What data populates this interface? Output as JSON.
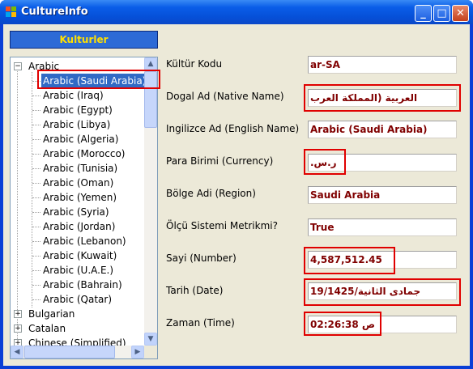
{
  "window": {
    "title": "CultureInfo",
    "icon": "windows-form-icon",
    "buttons": {
      "minimize": "_",
      "maximize": "□",
      "close": "✕"
    }
  },
  "sidebar": {
    "button_label": "Kulturler",
    "tree": {
      "groups": [
        {
          "label": "Arabic",
          "expanded": true,
          "expander": "−"
        },
        {
          "label": "Bulgarian",
          "expanded": false,
          "expander": "+"
        },
        {
          "label": "Catalan",
          "expanded": false,
          "expander": "+"
        },
        {
          "label": "Chinese (Simplified)",
          "expanded": false,
          "expander": "+"
        }
      ],
      "arabic_children": [
        "Arabic (Saudi Arabia)",
        "Arabic (Iraq)",
        "Arabic (Egypt)",
        "Arabic (Libya)",
        "Arabic (Algeria)",
        "Arabic (Morocco)",
        "Arabic (Tunisia)",
        "Arabic (Oman)",
        "Arabic (Yemen)",
        "Arabic (Syria)",
        "Arabic (Jordan)",
        "Arabic (Lebanon)",
        "Arabic (Kuwait)",
        "Arabic (U.A.E.)",
        "Arabic (Bahrain)",
        "Arabic (Qatar)"
      ],
      "selected": "Arabic (Saudi Arabia)"
    }
  },
  "fields": [
    {
      "label": "Kültür Kodu",
      "value": "ar-SA"
    },
    {
      "label": "Dogal Ad (Native Name)",
      "value": "العربية (المملكة العرب"
    },
    {
      "label": "Ingilizce Ad (English Name)",
      "value": "Arabic (Saudi Arabia)"
    },
    {
      "label": "Para Birimi (Currency)",
      "value": "ر.س.‏"
    },
    {
      "label": "Bölge Adi (Region)",
      "value": "Saudi Arabia"
    },
    {
      "label": "Ölçü Sistemi Metrikmi?",
      "value": "True"
    },
    {
      "label": "Sayi (Number)",
      "value": "4,587,512.45"
    },
    {
      "label": "Tarih (Date)",
      "value": "19/جمادى الثانية/1425"
    },
    {
      "label": "Zaman (Time)",
      "value": "02:26:38 ص"
    }
  ],
  "colors": {
    "title_bar": "#0a5de8",
    "selection": "#316ac5",
    "value_text": "#800000",
    "highlight_box": "#e00000",
    "button_text": "#ffe000"
  }
}
